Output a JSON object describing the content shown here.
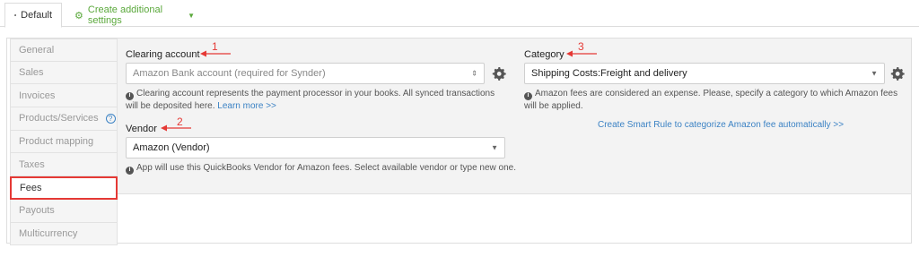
{
  "tabs": {
    "default_label": "Default",
    "create_label": "Create additional settings"
  },
  "sidebar": {
    "items": [
      {
        "label": "General"
      },
      {
        "label": "Sales"
      },
      {
        "label": "Invoices"
      },
      {
        "label": "Products/Services"
      },
      {
        "label": "Product mapping"
      },
      {
        "label": "Taxes"
      },
      {
        "label": "Fees",
        "active": true
      },
      {
        "label": "Payouts"
      },
      {
        "label": "Multicurrency"
      }
    ]
  },
  "clearing": {
    "label": "Clearing account",
    "placeholder": "Amazon Bank account (required for Synder)",
    "help": "Clearing account represents the payment processor in your books. All synced transactions will be deposited here.",
    "help_link": "Learn more >>"
  },
  "vendor": {
    "label": "Vendor",
    "value": "Amazon (Vendor)",
    "help": "App will use this QuickBooks Vendor for Amazon fees. Select available vendor or type new one."
  },
  "category": {
    "label": "Category",
    "value": "Shipping Costs:Freight and delivery",
    "help": "Amazon fees are considered an expense. Please, specify a category to which Amazon fees will be applied.",
    "smart_rule_link": "Create Smart Rule to categorize Amazon fee automatically >>"
  },
  "annotations": {
    "one": "1",
    "two": "2",
    "three": "3"
  },
  "colors": {
    "accent_green": "#5aa83b",
    "link_blue": "#3b82c4",
    "annotation_red": "#e53935"
  }
}
